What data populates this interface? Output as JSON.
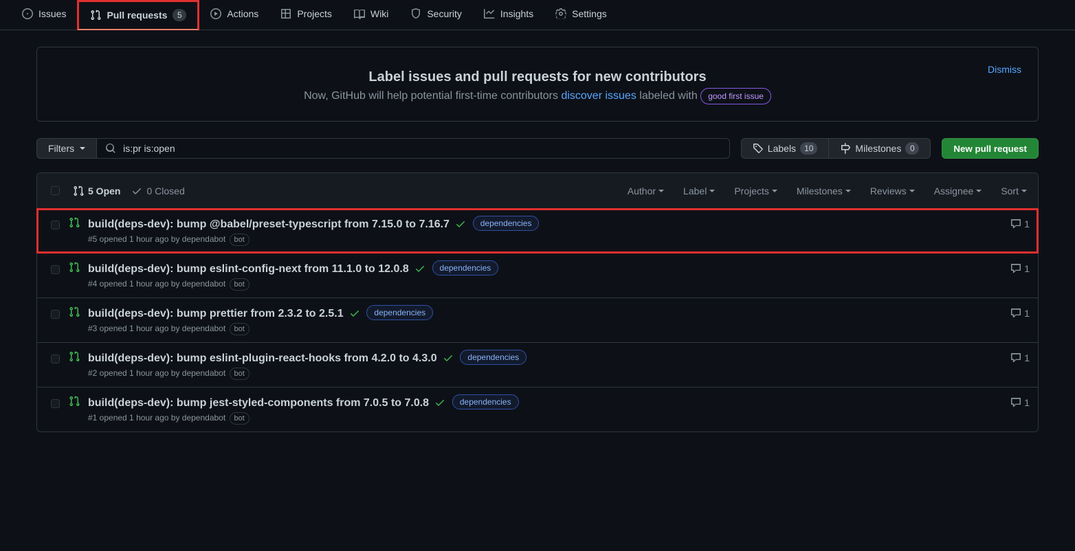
{
  "nav": {
    "items": [
      {
        "key": "issues",
        "label": "Issues",
        "icon": "issue"
      },
      {
        "key": "pulls",
        "label": "Pull requests",
        "icon": "pr",
        "count": "5",
        "selected": true,
        "highlight": true
      },
      {
        "key": "actions",
        "label": "Actions",
        "icon": "play"
      },
      {
        "key": "projects",
        "label": "Projects",
        "icon": "table"
      },
      {
        "key": "wiki",
        "label": "Wiki",
        "icon": "book"
      },
      {
        "key": "security",
        "label": "Security",
        "icon": "shield"
      },
      {
        "key": "insights",
        "label": "Insights",
        "icon": "graph"
      },
      {
        "key": "settings",
        "label": "Settings",
        "icon": "gear"
      }
    ]
  },
  "banner": {
    "title": "Label issues and pull requests for new contributors",
    "lead": "Now, GitHub will help potential first-time contributors ",
    "link": "discover issues",
    "tail": " labeled with ",
    "label": "good first issue",
    "dismiss": "Dismiss"
  },
  "filters": {
    "button": "Filters",
    "query": "is:pr is:open",
    "labels": {
      "text": "Labels",
      "count": "10"
    },
    "milestones": {
      "text": "Milestones",
      "count": "0"
    },
    "new_pr": "New pull request"
  },
  "list": {
    "open_count": "5 Open",
    "closed_count": "0 Closed",
    "toolbar": [
      "Author",
      "Label",
      "Projects",
      "Milestones",
      "Reviews",
      "Assignee",
      "Sort"
    ]
  },
  "prs": [
    {
      "id": "5",
      "title": "build(deps-dev): bump @babel/preset-typescript from 7.15.0 to 7.16.7",
      "highlight": true
    },
    {
      "id": "4",
      "title": "build(deps-dev): bump eslint-config-next from 11.1.0 to 12.0.8"
    },
    {
      "id": "3",
      "title": "build(deps-dev): bump prettier from 2.3.2 to 2.5.1"
    },
    {
      "id": "2",
      "title": "build(deps-dev): bump eslint-plugin-react-hooks from 4.2.0 to 4.3.0"
    },
    {
      "id": "1",
      "title": "build(deps-dev): bump jest-styled-components from 7.0.5 to 7.0.8"
    }
  ],
  "pr_common": {
    "opened_ago": "opened 1 hour ago by",
    "author": "dependabot",
    "bot": "bot",
    "dep_label": "dependencies",
    "comments": "1"
  }
}
